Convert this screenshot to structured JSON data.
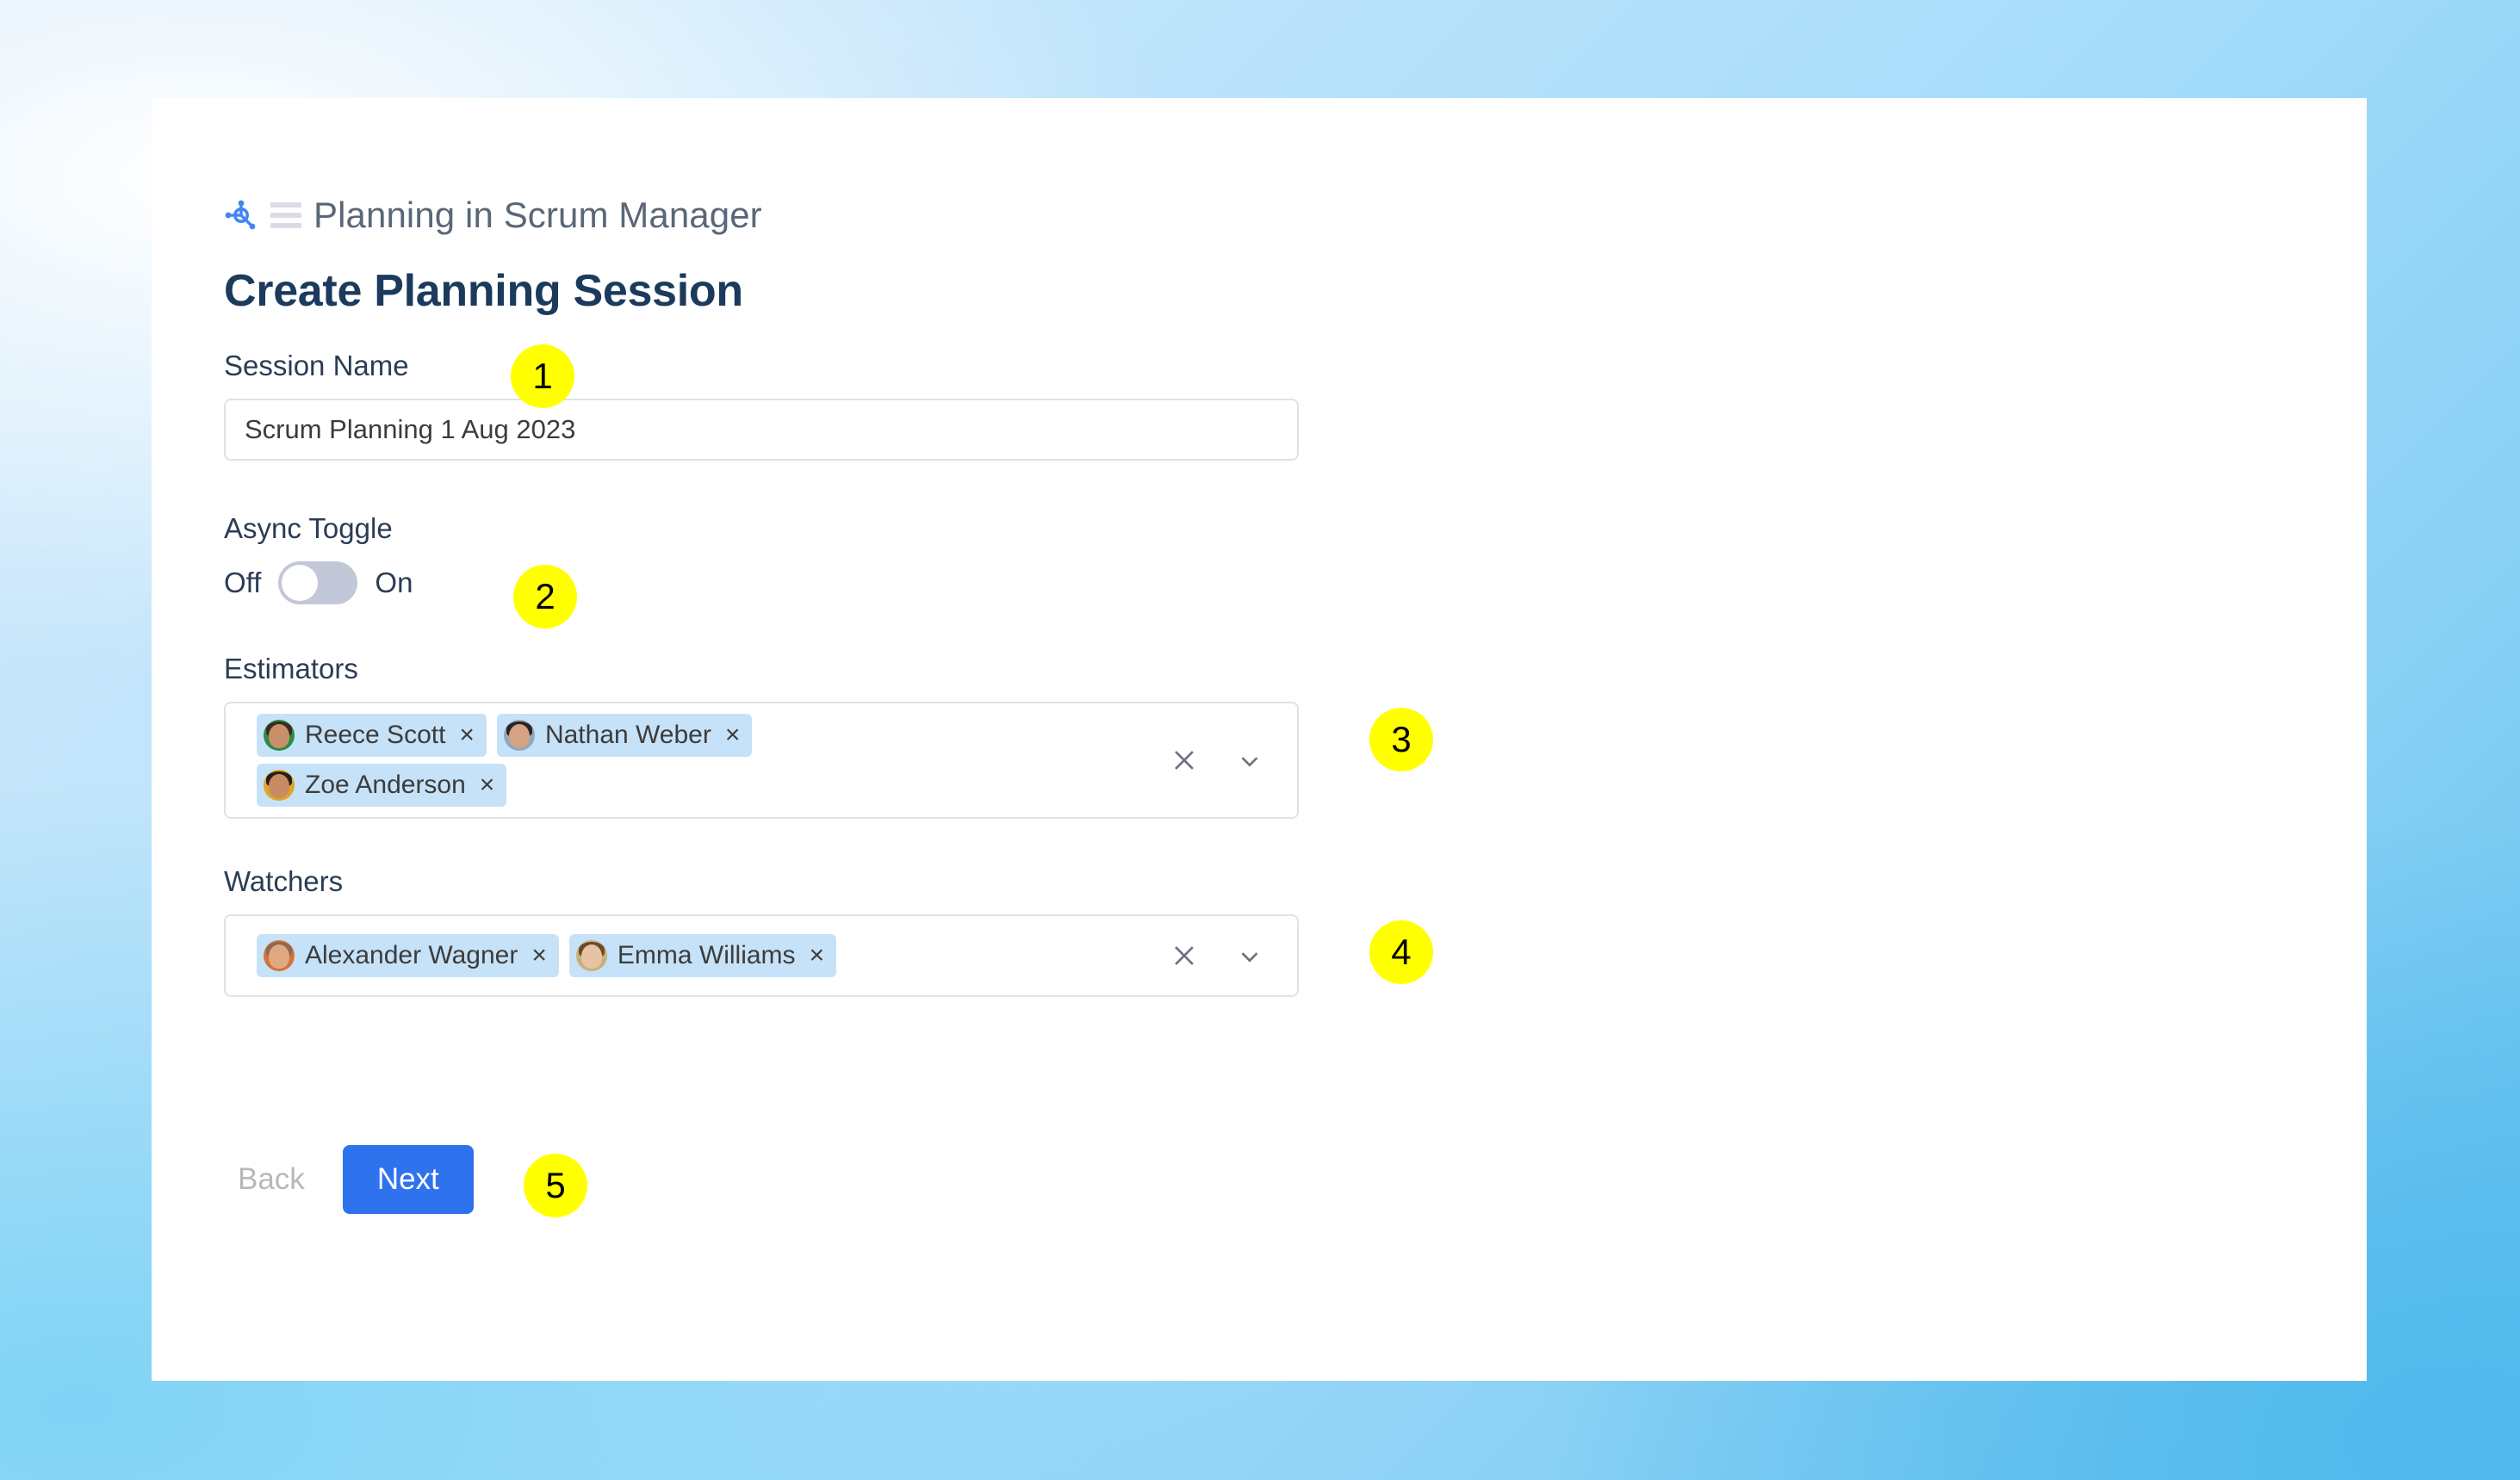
{
  "background": {
    "gradient_from": "#cfe8fa",
    "gradient_to": "#62c2ef"
  },
  "card": {
    "background": "#ffffff"
  },
  "breadcrumb": {
    "node_icon": "node-graph-icon",
    "menu_icon": "hamburger-menu-icon",
    "text": "Planning in Scrum Manager",
    "text_color": "#5a6778"
  },
  "page_title": "Create Planning Session",
  "page_title_color": "#1b3a5c",
  "fields": {
    "session_name": {
      "label": "Session Name",
      "value": "Scrum Planning 1 Aug 2023",
      "placeholder": "Session Name"
    },
    "async_toggle": {
      "label": "Async Toggle",
      "off_label": "Off",
      "on_label": "On",
      "state": "off",
      "track_color": "#c2c8d8",
      "knob_color": "#ffffff"
    },
    "estimators": {
      "label": "Estimators",
      "chip_background": "#c6e2f8",
      "clear_icon": "close-icon",
      "caret_icon": "chevron-down-icon",
      "chips": [
        {
          "name": "Reece Scott",
          "remove": "×",
          "avatar_bg": "#2e8b45",
          "avatar_skin": "#c98f6a",
          "avatar_hair": "#3a2a20"
        },
        {
          "name": "Nathan Weber",
          "remove": "×",
          "avatar_bg": "#8fa8bd",
          "avatar_skin": "#d5a383",
          "avatar_hair": "#2b2320"
        },
        {
          "name": "Zoe Anderson",
          "remove": "×",
          "avatar_bg": "#e0a429",
          "avatar_skin": "#c98b63",
          "avatar_hair": "#2a1d16"
        }
      ]
    },
    "watchers": {
      "label": "Watchers",
      "chip_background": "#c6e2f8",
      "clear_icon": "close-icon",
      "caret_icon": "chevron-down-icon",
      "chips": [
        {
          "name": "Alexander Wagner",
          "remove": "×",
          "avatar_bg": "#d4713c",
          "avatar_skin": "#e0a87f",
          "avatar_hair": "#8d6a4e"
        },
        {
          "name": "Emma Williams",
          "remove": "×",
          "avatar_bg": "#c8b07a",
          "avatar_skin": "#e8c3a3",
          "avatar_hair": "#6b4a2c"
        }
      ]
    }
  },
  "footer": {
    "back_label": "Back",
    "back_color": "#b8b8b8",
    "next_label": "Next",
    "next_background": "#2f72ee",
    "next_color": "#ffffff"
  },
  "step_badges": [
    {
      "number": "1"
    },
    {
      "number": "2"
    },
    {
      "number": "3"
    },
    {
      "number": "4"
    },
    {
      "number": "5"
    }
  ],
  "badge_color": "#ffff00"
}
